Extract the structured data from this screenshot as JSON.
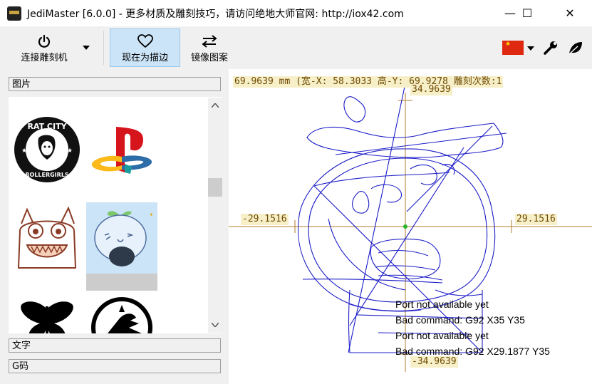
{
  "window": {
    "title": "JediMaster [6.0.0]  - 更多材质及雕刻技巧，请访问绝地大师官网: http://iox42.com",
    "minimize_glyph": "—",
    "maximize_glyph": "☐",
    "close_glyph": "✕"
  },
  "toolbar": {
    "connect_label": "连接雕刻机",
    "trace_label": "现在为描边",
    "mirror_label": "镜像图案",
    "language_flag": "cn-flag-icon",
    "settings_icon": "wrench-icon",
    "leaf_icon": "leaf-icon"
  },
  "left_panel": {
    "images_header": "图片",
    "text_header": "文字",
    "gcode_header": "G码",
    "thumbnails": [
      {
        "name": "rat-city-rollergirls-logo",
        "text_top": "RAT CITY",
        "text_bottom": "ROLLERGIRLS"
      },
      {
        "name": "playstation-logo"
      },
      {
        "name": "monster-cartoon"
      },
      {
        "name": "bean-sprout-cartoon",
        "selected": true
      },
      {
        "name": "butterfly-silhouette"
      },
      {
        "name": "bird-badge"
      }
    ]
  },
  "canvas": {
    "info_line": "69.9639 mm  (宽-X: 58.3033  高-Y: 69.9278  雕刻次数:1",
    "y_top": "34.9639",
    "y_bottom": "-34.9639",
    "x_left": "-29.1516",
    "x_right": "29.1516",
    "log": [
      "Port not available yet",
      "Bad command: G92 X35 Y35",
      "Port not available yet",
      "Bad command: G92 X29.1877 Y35"
    ],
    "colors": {
      "axis": "#b07c2a",
      "trace": "#1c1cc8",
      "origin": "#2bb52b"
    }
  }
}
